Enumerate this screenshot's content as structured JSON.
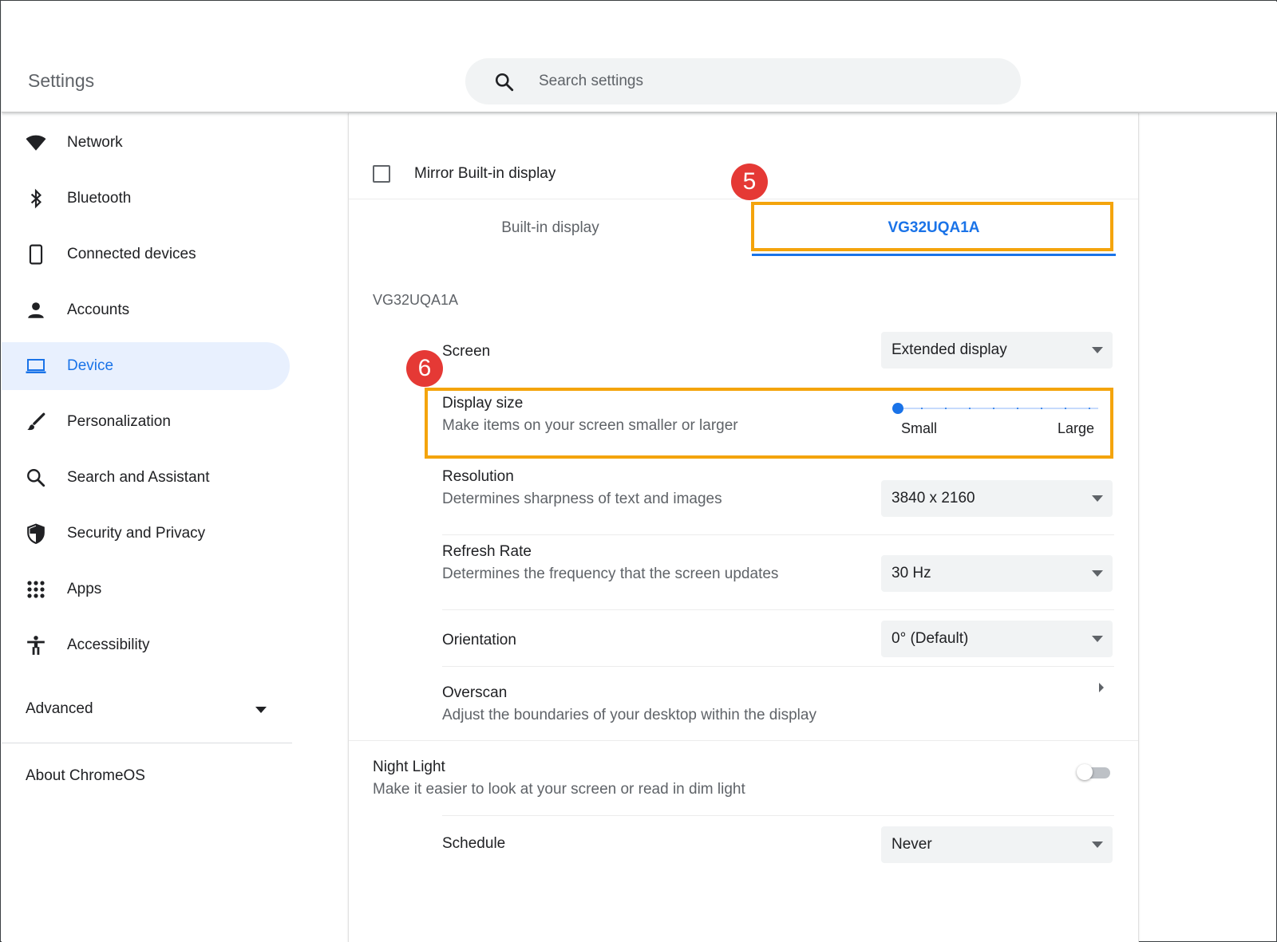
{
  "window": {
    "controls": [
      "minimize-icon",
      "maximize-icon",
      "close-icon"
    ]
  },
  "header": {
    "title": "Settings",
    "search": {
      "placeholder": "Search settings",
      "value": ""
    }
  },
  "sidebar": {
    "items": [
      {
        "label": "Network",
        "icon": "wifi-icon"
      },
      {
        "label": "Bluetooth",
        "icon": "bluetooth-icon"
      },
      {
        "label": "Connected devices",
        "icon": "phone-icon"
      },
      {
        "label": "Accounts",
        "icon": "person-icon"
      },
      {
        "label": "Device",
        "icon": "laptop-icon",
        "active": true
      },
      {
        "label": "Personalization",
        "icon": "brush-icon"
      },
      {
        "label": "Search and Assistant",
        "icon": "search-icon"
      },
      {
        "label": "Security and Privacy",
        "icon": "shield-icon"
      },
      {
        "label": "Apps",
        "icon": "apps-grid-icon"
      },
      {
        "label": "Accessibility",
        "icon": "accessibility-icon"
      }
    ],
    "advanced": "Advanced",
    "about": "About ChromeOS"
  },
  "display": {
    "mirror_label": "Mirror Built-in display",
    "mirror_checked": false,
    "tabs": [
      {
        "label": "Built-in display",
        "selected": false
      },
      {
        "label": "VG32UQA1A",
        "selected": true
      }
    ],
    "section_title": "VG32UQA1A",
    "screen": {
      "label": "Screen",
      "value": "Extended display"
    },
    "display_size": {
      "label": "Display size",
      "description": "Make items on your screen smaller or larger",
      "min_label": "Small",
      "max_label": "Large",
      "level_fraction": 0.0
    },
    "resolution": {
      "label": "Resolution",
      "description": "Determines sharpness of text and images",
      "value": "3840 x 2160"
    },
    "refresh_rate": {
      "label": "Refresh Rate",
      "description": "Determines the frequency that the screen updates",
      "value": "30 Hz"
    },
    "orientation": {
      "label": "Orientation",
      "value": "0° (Default)"
    },
    "overscan": {
      "label": "Overscan",
      "description": "Adjust the boundaries of your desktop within the display"
    },
    "night_light": {
      "label": "Night Light",
      "description": "Make it easier to look at your screen or read in dim light",
      "enabled": false
    },
    "schedule": {
      "label": "Schedule",
      "value": "Never"
    }
  },
  "annotations": {
    "step5": "5",
    "step6": "6",
    "highlight_color": "#f4a40c",
    "badge_color": "#e53935"
  },
  "colors": {
    "accent": "#1a73e8",
    "active_bg": "#e8f0fe"
  }
}
